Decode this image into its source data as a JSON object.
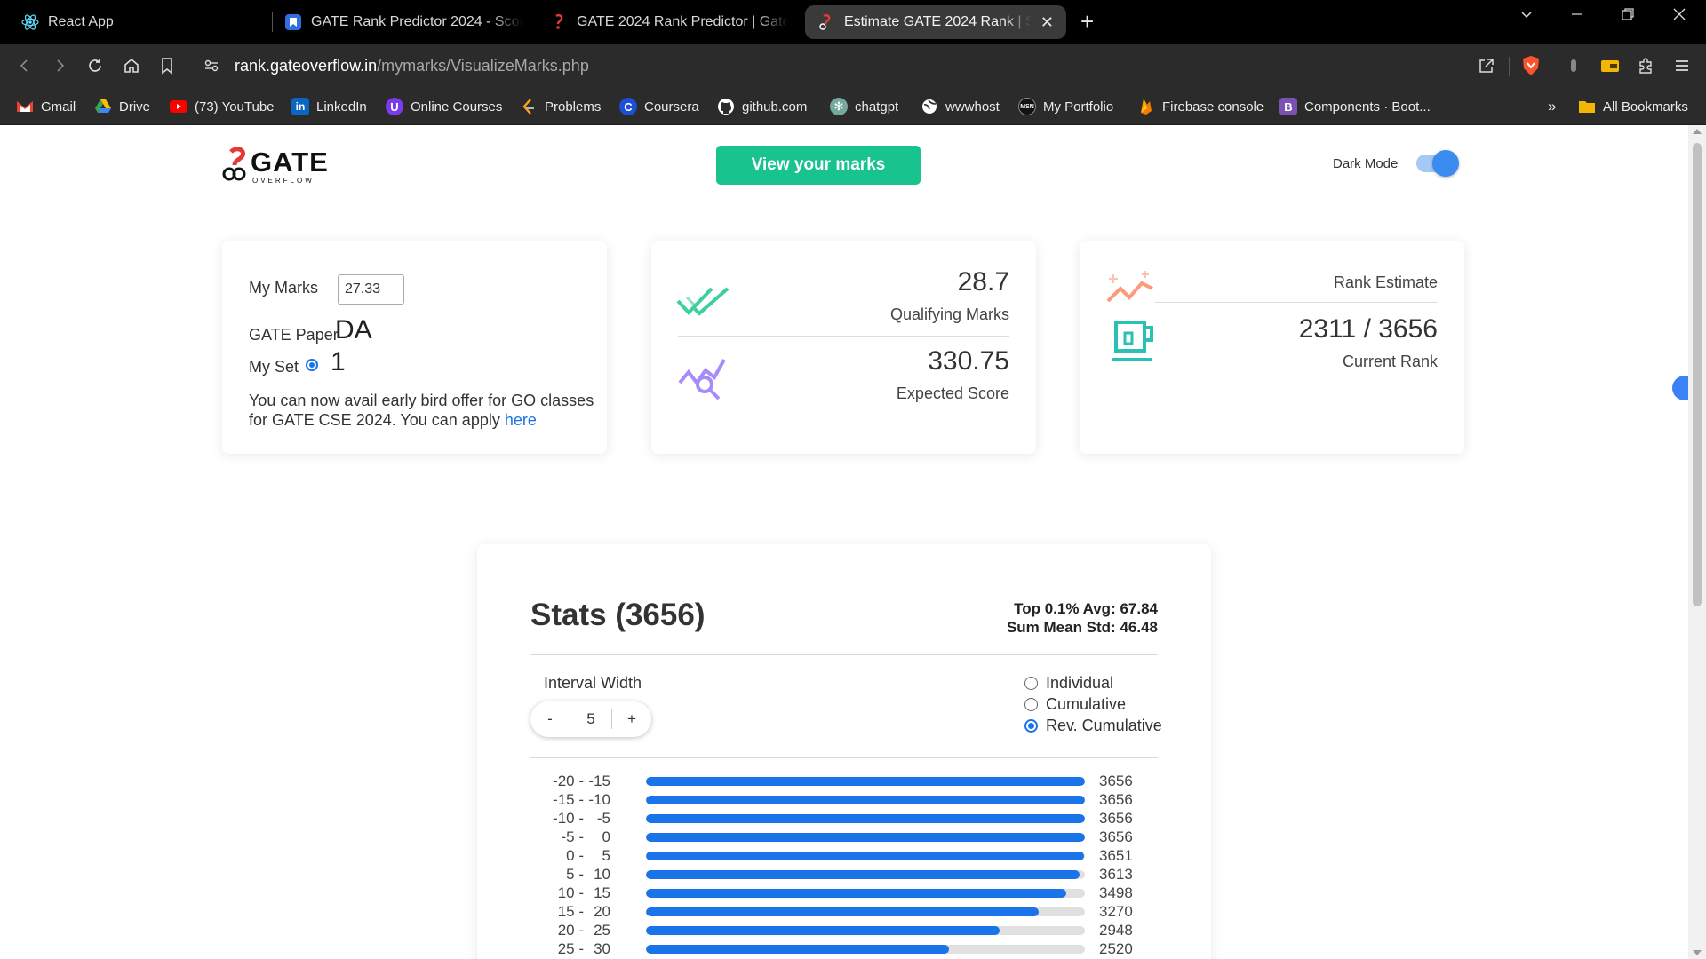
{
  "browser": {
    "tabs": [
      {
        "title": "React App",
        "icon": "react-icon"
      },
      {
        "title": "GATE Rank Predictor 2024 - Score Ca",
        "icon": "bookmark-tab-icon"
      },
      {
        "title": "GATE 2024 Rank Predictor | Gateover",
        "icon": "gateoverflow-icon"
      },
      {
        "title": "Estimate GATE 2024 Rank | See I",
        "icon": "gateoverflow-icon",
        "active": true
      }
    ],
    "url_domain": "rank.gateoverflow.in",
    "url_path": "/mymarks/VisualizeMarks.php",
    "bookmarks": [
      {
        "label": "Gmail",
        "icon": "gmail-icon"
      },
      {
        "label": "Drive",
        "icon": "drive-icon"
      },
      {
        "label": "(73) YouTube",
        "icon": "youtube-icon"
      },
      {
        "label": "LinkedIn",
        "icon": "linkedin-icon"
      },
      {
        "label": "Online Courses",
        "icon": "courses-icon"
      },
      {
        "label": "Problems",
        "icon": "problems-icon"
      },
      {
        "label": "Coursera",
        "icon": "coursera-icon"
      },
      {
        "label": "github.com",
        "icon": "github-icon"
      },
      {
        "label": "chatgpt",
        "icon": "chatgpt-icon"
      },
      {
        "label": "wwwhost",
        "icon": "wwwhost-icon"
      },
      {
        "label": "My Portfolio",
        "icon": "portfolio-icon"
      },
      {
        "label": "Firebase console",
        "icon": "firebase-icon"
      },
      {
        "label": "Components · Boot...",
        "icon": "bootstrap-icon"
      }
    ],
    "bookmarks_more": "»",
    "all_bookmarks": "All Bookmarks"
  },
  "header": {
    "logo_word": "GATE",
    "logo_sub": "OVERFLOW",
    "view_marks_label": "View your marks",
    "dark_mode_label": "Dark Mode"
  },
  "card_marks": {
    "my_marks_label": "My Marks",
    "my_marks_value": "27.33",
    "paper_label": "GATE Paper",
    "paper_value": "DA",
    "set_label": "My Set",
    "set_value": "1",
    "offer_text": "You can now avail early bird offer for GO classes for GATE CSE 2024. You can apply ",
    "offer_link": "here"
  },
  "card_score": {
    "qualifying_value": "28.7",
    "qualifying_label": "Qualifying Marks",
    "expected_value": "330.75",
    "expected_label": "Expected Score"
  },
  "card_rank": {
    "title": "Rank Estimate",
    "rank_value": "2311 / 3656",
    "rank_label": "Current Rank"
  },
  "stats": {
    "title": "Stats (3656)",
    "top_avg": "Top 0.1% Avg: 67.84",
    "sum_mean_std": "Sum Mean Std: 46.48",
    "interval_label": "Interval Width",
    "minus": "-",
    "interval_value": "5",
    "plus": "+",
    "modes": [
      {
        "label": "Individual",
        "selected": false
      },
      {
        "label": "Cumulative",
        "selected": false
      },
      {
        "label": "Rev. Cumulative",
        "selected": true
      }
    ],
    "accent": "#1a73e8"
  },
  "chart_data": {
    "type": "bar",
    "orientation": "horizontal",
    "max": 3656,
    "bins": [
      {
        "lo": "-20 -",
        "hi": "-15",
        "value": 3656
      },
      {
        "lo": "-15 -",
        "hi": "-10",
        "value": 3656
      },
      {
        "lo": "-10 -",
        "hi": "-5",
        "value": 3656
      },
      {
        "lo": "-5 -",
        "hi": "0",
        "value": 3656
      },
      {
        "lo": "0 -",
        "hi": "5",
        "value": 3651
      },
      {
        "lo": "5 -",
        "hi": "10",
        "value": 3613
      },
      {
        "lo": "10 -",
        "hi": "15",
        "value": 3498
      },
      {
        "lo": "15 -",
        "hi": "20",
        "value": 3270
      },
      {
        "lo": "20 -",
        "hi": "25",
        "value": 2948
      },
      {
        "lo": "25 -",
        "hi": "30",
        "value": 2520
      }
    ]
  }
}
